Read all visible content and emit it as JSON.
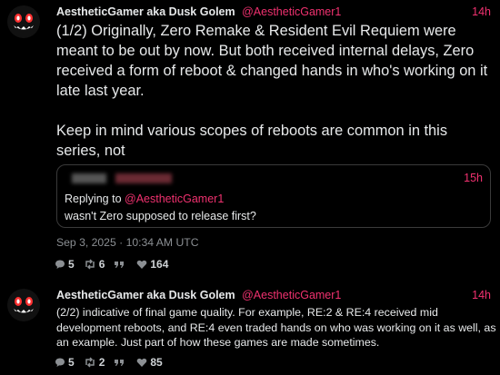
{
  "post1": {
    "author_name": "AestheticGamer aka Dusk Golem",
    "author_handle": "@AestheticGamer1",
    "time": "14h",
    "paragraph1": "(1/2) Originally, Zero Remake & Resident Evil Requiem were meant to be out by now. But both received internal delays, Zero received a form of reboot & changed hands in who's working on it late last year.",
    "paragraph2": "Keep in mind various scopes of reboots are common in this series, not",
    "quote": {
      "time": "15h",
      "replying_prefix": "Replying to",
      "replying_handle": "@AestheticGamer1",
      "text": "wasn't Zero supposed to release first?"
    },
    "timestamp": "Sep 3, 2025 · 10:34 AM UTC",
    "replies": "5",
    "reposts": "6",
    "likes": "164"
  },
  "post2": {
    "author_name": "AestheticGamer aka Dusk Golem",
    "author_handle": "@AestheticGamer1",
    "time": "14h",
    "text": "(2/2) indicative of final game quality. For example, RE:2 & RE:4 received mid development reboots, and RE:4 even traded hands on who was working on it as well, as an example. Just part of how these games are made sometimes.",
    "replies": "5",
    "reposts": "2",
    "likes": "85"
  },
  "colors": {
    "accent": "#f0316f",
    "muted": "#8b8f93",
    "background": "#000000"
  },
  "icons": [
    "reply-icon",
    "repost-icon",
    "quote-icon",
    "like-icon"
  ]
}
